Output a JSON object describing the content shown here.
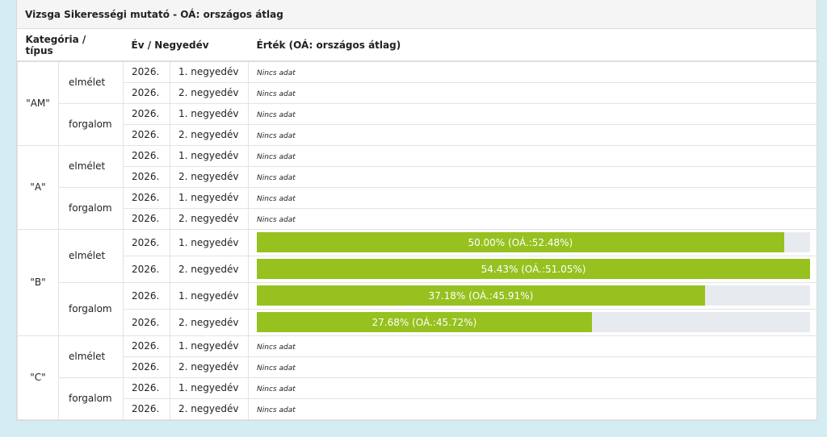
{
  "panel": {
    "title": "Vizsga Sikerességi mutató - OÁ: országos átlag"
  },
  "table": {
    "headers": {
      "category": "Kategória / típus",
      "period": "Év / Negyedév",
      "value": "Érték (OÁ: országos átlag)"
    },
    "no_data_label": "Nincs adat",
    "bar_color": "#96c11f",
    "track_color": "#e7eaee",
    "groups": [
      {
        "category": "\"AM\"",
        "types": [
          {
            "type": "elmélet",
            "rows": [
              {
                "year": "2026.",
                "quarter": "1. negyedév",
                "value": null,
                "label": "Nincs adat"
              },
              {
                "year": "2026.",
                "quarter": "2. negyedév",
                "value": null,
                "label": "Nincs adat"
              }
            ]
          },
          {
            "type": "forgalom",
            "rows": [
              {
                "year": "2026.",
                "quarter": "1. negyedév",
                "value": null,
                "label": "Nincs adat"
              },
              {
                "year": "2026.",
                "quarter": "2. negyedév",
                "value": null,
                "label": "Nincs adat"
              }
            ]
          }
        ]
      },
      {
        "category": "\"A\"",
        "types": [
          {
            "type": "elmélet",
            "rows": [
              {
                "year": "2026.",
                "quarter": "1. negyedév",
                "value": null,
                "label": "Nincs adat"
              },
              {
                "year": "2026.",
                "quarter": "2. negyedév",
                "value": null,
                "label": "Nincs adat"
              }
            ]
          },
          {
            "type": "forgalom",
            "rows": [
              {
                "year": "2026.",
                "quarter": "1. negyedév",
                "value": null,
                "label": "Nincs adat"
              },
              {
                "year": "2026.",
                "quarter": "2. negyedév",
                "value": null,
                "label": "Nincs adat"
              }
            ]
          }
        ]
      },
      {
        "category": "\"B\"",
        "types": [
          {
            "type": "elmélet",
            "rows": [
              {
                "year": "2026.",
                "quarter": "1. negyedév",
                "value": 50.0,
                "national_avg": 52.48,
                "label": "50.00% (OÁ.:52.48%)"
              },
              {
                "year": "2026.",
                "quarter": "2. negyedév",
                "value": 54.43,
                "national_avg": 51.05,
                "label": "54.43% (OÁ.:51.05%)"
              }
            ]
          },
          {
            "type": "forgalom",
            "rows": [
              {
                "year": "2026.",
                "quarter": "1. negyedév",
                "value": 37.18,
                "national_avg": 45.91,
                "label": "37.18% (OÁ.:45.91%)"
              },
              {
                "year": "2026.",
                "quarter": "2. negyedév",
                "value": 27.68,
                "national_avg": 45.72,
                "label": "27.68% (OÁ.:45.72%)"
              }
            ]
          }
        ]
      },
      {
        "category": "\"C\"",
        "types": [
          {
            "type": "elmélet",
            "rows": [
              {
                "year": "2026.",
                "quarter": "1. negyedév",
                "value": null,
                "label": "Nincs adat"
              },
              {
                "year": "2026.",
                "quarter": "2. negyedév",
                "value": null,
                "label": "Nincs adat"
              }
            ]
          },
          {
            "type": "forgalom",
            "rows": [
              {
                "year": "2026.",
                "quarter": "1. negyedév",
                "value": null,
                "label": "Nincs adat"
              },
              {
                "year": "2026.",
                "quarter": "2. negyedév",
                "value": null,
                "label": "Nincs adat"
              }
            ]
          }
        ]
      }
    ]
  }
}
